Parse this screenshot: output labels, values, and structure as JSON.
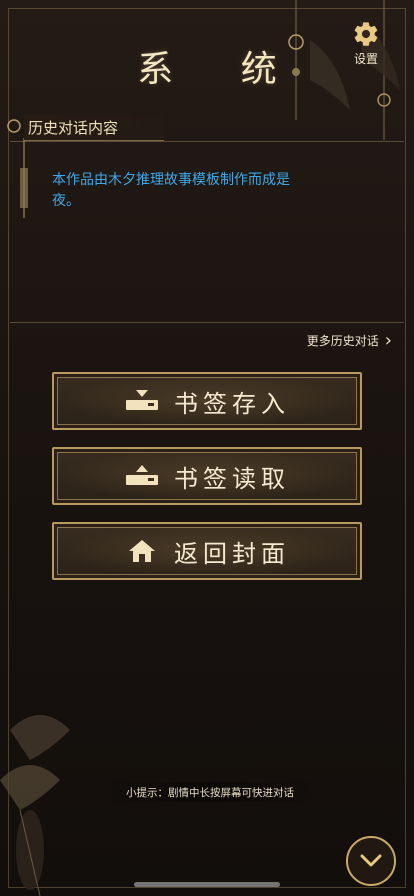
{
  "header": {
    "title": "系 统"
  },
  "settings": {
    "label": "设置",
    "icon": "gear-icon"
  },
  "history": {
    "tag": "历史对话内容",
    "text": "本作品由木夕推理故事模板制作而成是夜。",
    "more_label": "更多历史对话"
  },
  "menu": {
    "save_bookmark": "书签存入",
    "load_bookmark": "书签读取",
    "return_cover": "返回封面"
  },
  "tip": {
    "text": "小提示：剧情中长按屏幕可快进对话"
  },
  "colors": {
    "gold": "#c9a868",
    "text_blue": "#3fa8e8",
    "bg": "#1c1511"
  }
}
